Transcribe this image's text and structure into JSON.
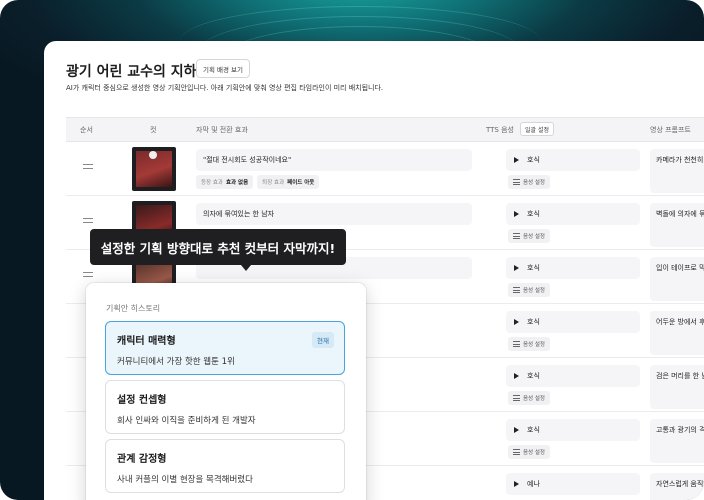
{
  "page": {
    "title": "광기 어린 교수의 지하실",
    "plan_button": "기획 배경 보기",
    "subtitle": "AI가 캐릭터 중심으로 생성한 영상 기획안입니다. 아래 기획안에 맞춰 영상 편집 타임라인이 미리 배치됩니다."
  },
  "table": {
    "headers": {
      "order": "순서",
      "cut": "컷",
      "subtitle": "자막 및 전환 효과",
      "tts": "TTS 음성",
      "prompt": "영상 프롬프트"
    },
    "tts_apply_all": "일괄 설정",
    "voice_settings_label": "음성 설정",
    "rows": [
      {
        "subtitle": "\"절대 전시회도 성공작이네요\"",
        "tags": [
          {
            "label": "등장 효과",
            "value": "효과 없음"
          },
          {
            "label": "퇴장 효과",
            "value": "페이드 아웃"
          }
        ],
        "voice": "호식",
        "prompt": "카메라가 천천히 줌인하"
      },
      {
        "subtitle": "의자에 묶여있는 한 남자",
        "voice": "호식",
        "prompt": "벽돌에 의자에 묶인 남"
      },
      {
        "subtitle": "",
        "voice": "호식",
        "prompt": "입이 테이프로 막힌 남"
      },
      {
        "subtitle": "",
        "voice": "호식",
        "prompt": "어두운 방에서 후드를 쓴"
      },
      {
        "subtitle": "",
        "voice": "호식",
        "prompt": "검은 머리를 한 남자가"
      },
      {
        "subtitle": "",
        "voice": "호식",
        "prompt": "고통과 광기의 격렬한"
      },
      {
        "subtitle": "",
        "voice": "예나",
        "prompt": "자연스럽게 움직임"
      }
    ]
  },
  "tooltip": {
    "text": "설정한 기획 방향대로 추천 컷부터 자막까지!"
  },
  "history": {
    "title": "기획안 히스토리",
    "items": [
      {
        "name": "캐릭터 매력형",
        "desc": "커뮤니티에서 가장 핫한 웹툰 1위",
        "badge": "현재"
      },
      {
        "name": "설정 컨셉형",
        "desc": "회사 인싸와 이직을 준비하게 된 개발자"
      },
      {
        "name": "관계 감정형",
        "desc": "사내 커플의 이별 현장을 목격해버렸다"
      }
    ]
  }
}
